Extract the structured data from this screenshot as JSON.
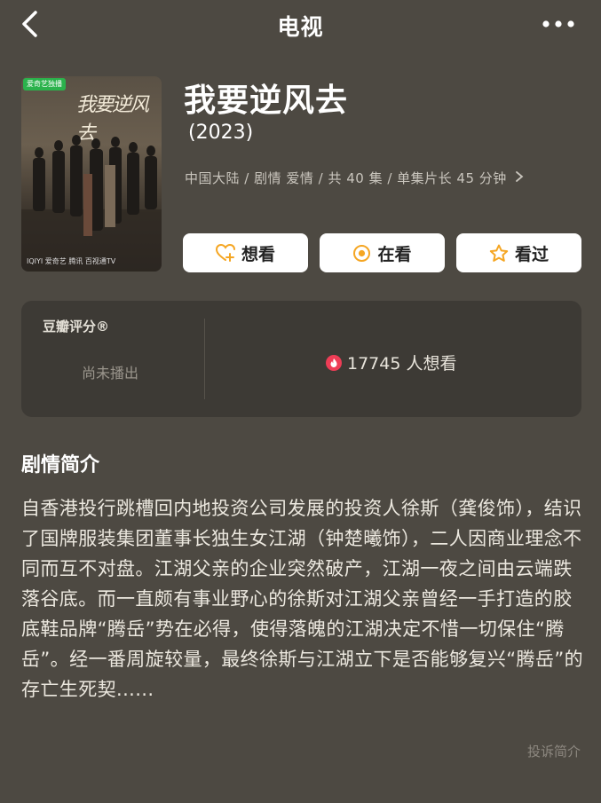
{
  "header": {
    "title": "电视"
  },
  "poster": {
    "badge": "爱奇艺独播",
    "title_art": "我要逆风去",
    "footer": "IQIYI 爱奇艺  腾讯  百视通TV"
  },
  "show": {
    "name": "我要逆风去",
    "year": "(2023)",
    "meta": "中国大陆 / 剧情 爱情 / 共 40 集 / 单集片长 45 分钟"
  },
  "actions": {
    "want_label": "想看",
    "watching_label": "在看",
    "watched_label": "看过"
  },
  "rating": {
    "label": "豆瓣评分®",
    "status": "尚未播出",
    "want_count": "17745 人想看"
  },
  "synopsis": {
    "title": "剧情简介",
    "text": "自香港投行跳槽回内地投资公司发展的投资人徐斯（龚俊饰），结识了国牌服装集团董事长独生女江湖（钟楚曦饰），二人因商业理念不同而互不对盘。江湖父亲的企业突然破产，江湖一夜之间由云端跌落谷底。而一直颇有事业野心的徐斯对江湖父亲曾经一手打造的胶底鞋品牌“腾岳”势在必得，使得落魄的江湖决定不惜一切保住“腾岳”。经一番周旋较量，最终徐斯与江湖立下是否能够复兴“腾岳”的存亡生死契......",
    "report_label": "投诉简介"
  },
  "colors": {
    "background": "#4d4942",
    "card": "#3d3a35",
    "accent": "#f5a623",
    "fire": "#ee3d56"
  }
}
